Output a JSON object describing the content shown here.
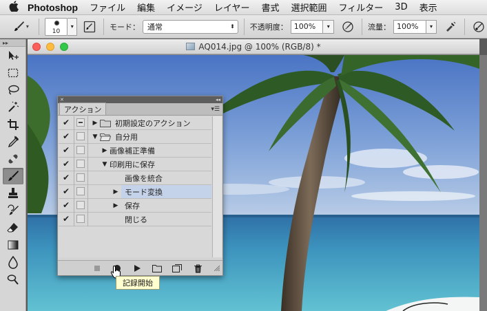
{
  "menubar": {
    "apple_icon": "apple-icon",
    "items": [
      "Photoshop",
      "ファイル",
      "編集",
      "イメージ",
      "レイヤー",
      "書式",
      "選択範囲",
      "フィルター",
      "3D",
      "表示"
    ]
  },
  "options": {
    "brush_size": "10",
    "mode_label": "モード：",
    "mode_value": "通常",
    "opacity_label": "不透明度：",
    "opacity_value": "100%",
    "flow_label": "流量：",
    "flow_value": "100%"
  },
  "document": {
    "title": "AQ014.jpg @ 100% (RGB/8) *"
  },
  "actions_panel": {
    "tab_label": "アクション",
    "rows": [
      {
        "label": "初期設定のアクション",
        "type": "set",
        "checked": true,
        "dialog": true,
        "expanded": false,
        "indent": 0
      },
      {
        "label": "自分用",
        "type": "set",
        "checked": true,
        "dialog": false,
        "expanded": true,
        "indent": 0
      },
      {
        "label": "画像補正準備",
        "type": "action",
        "checked": true,
        "dialog": false,
        "expanded": false,
        "indent": 1
      },
      {
        "label": "印刷用に保存",
        "type": "action",
        "checked": true,
        "dialog": false,
        "expanded": true,
        "indent": 1
      },
      {
        "label": "画像を統合",
        "type": "step",
        "checked": true,
        "dialog": false,
        "expanded": null,
        "indent": 2
      },
      {
        "label": "モード変換",
        "type": "step",
        "checked": true,
        "dialog": false,
        "expanded": false,
        "indent": 2,
        "selected": true
      },
      {
        "label": "保存",
        "type": "step",
        "checked": true,
        "dialog": false,
        "expanded": false,
        "indent": 2
      },
      {
        "label": "閉じる",
        "type": "step",
        "checked": true,
        "dialog": false,
        "expanded": null,
        "indent": 2
      }
    ]
  },
  "tooltip": "記録開始"
}
